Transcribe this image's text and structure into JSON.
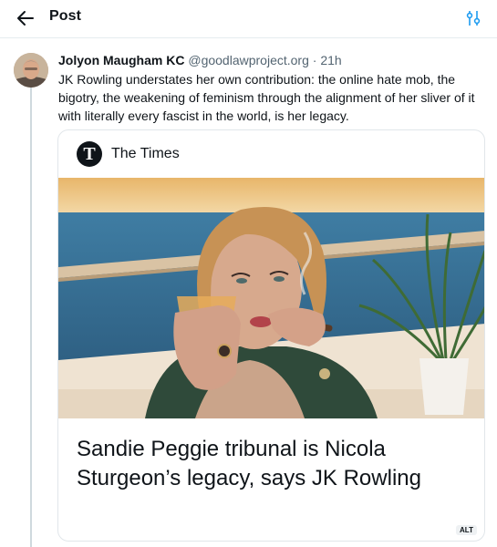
{
  "header": {
    "title": "Post",
    "back_icon": "arrow-left-icon",
    "tune_icon": "sliders-icon"
  },
  "post": {
    "author": "Jolyon Maugham KC",
    "handle": "@goodlawproject.org",
    "separator": " · ",
    "time": "21h",
    "text": "JK Rowling understates her own contribution: the online hate mob, the bigotry, the weakening of feminism through the alignment of her sliver of it with literally every fascist in the world, is her legacy.",
    "card": {
      "source_name": "The Times",
      "source_logo_letter": "T",
      "headline": "Sandie Peggie tribunal is Nicola Sturgeon’s legacy, says JK Rowling",
      "alt_label": "ALT"
    }
  },
  "colors": {
    "text": "#0f1419",
    "secondary": "#536471",
    "accent": "#1d9bf0",
    "border": "#e6ecf0"
  }
}
